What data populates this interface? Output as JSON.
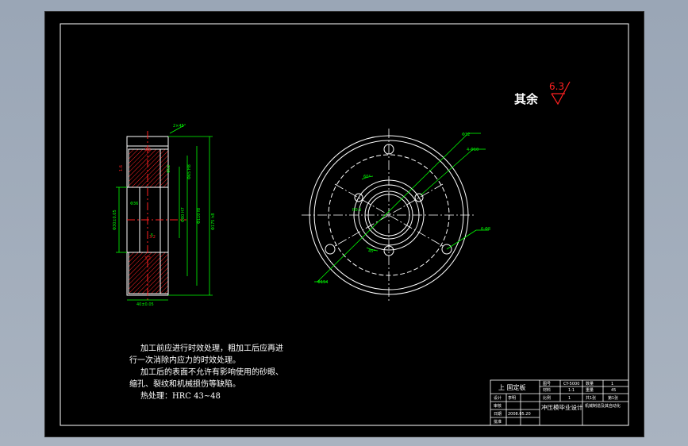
{
  "surface": {
    "remark": {
      "label": "其余",
      "roughness": "6.3"
    }
  },
  "notes": {
    "line1": "加工前应进行时效处理，粗加工后应再进",
    "line2": "行一次消除内应力的时效处理。",
    "line3": "加工后的表面不允许有影响使用的砂眼、",
    "line4": "缩孔、裂纹和机械损伤等缺陷。",
    "line5": "热处理：HRC 43~48"
  },
  "section_view": {
    "chamfer": "2×45°",
    "dims": {
      "d1": "Φ65 H8",
      "d2": "Φ40 H7",
      "d3": "Φ80 H7",
      "d4": "Φ95",
      "d5": "Φ110 f8",
      "d6": "Φ175 h8",
      "d7": "Φ52",
      "d8": "Φ36",
      "width": "40±0.05",
      "step": "5",
      "left": "Φ30±0.05"
    },
    "roughness": {
      "r1": "3.2",
      "r2": "1.6",
      "r3": "3.2",
      "r4": "3.2"
    }
  },
  "plan_view": {
    "labels": {
      "a": "Φ32",
      "b": "4-Φ10",
      "c": "60°",
      "d": "6-Φ8",
      "e": "R0.5",
      "f": "45°",
      "g": "Φ154"
    }
  },
  "title_block": {
    "part_name": "上 固定板",
    "project": "冲压模毕业设计",
    "school": "机械制造及其自动化",
    "cells": {
      "drawing_no_label": "图号",
      "drawing_no": "CY-5000",
      "qty_label": "数量",
      "qty": "1",
      "material_label": "材料",
      "material": "45",
      "scale_label": "比例",
      "scale": "1:1",
      "weight_label": "重量",
      "sheet": "共1张",
      "sheet_no": "第1张",
      "designer_label": "设计",
      "designer": "李明",
      "checker_label": "审核",
      "date_label": "日期",
      "date": "2008.05.20",
      "approve_label": "批准"
    }
  },
  "colors": {
    "background": "#a3adba",
    "paper": "#000000",
    "line": "#ffffff",
    "dimension": "#00ff00",
    "accent": "#ff2020",
    "hatch": "#ff2020"
  }
}
